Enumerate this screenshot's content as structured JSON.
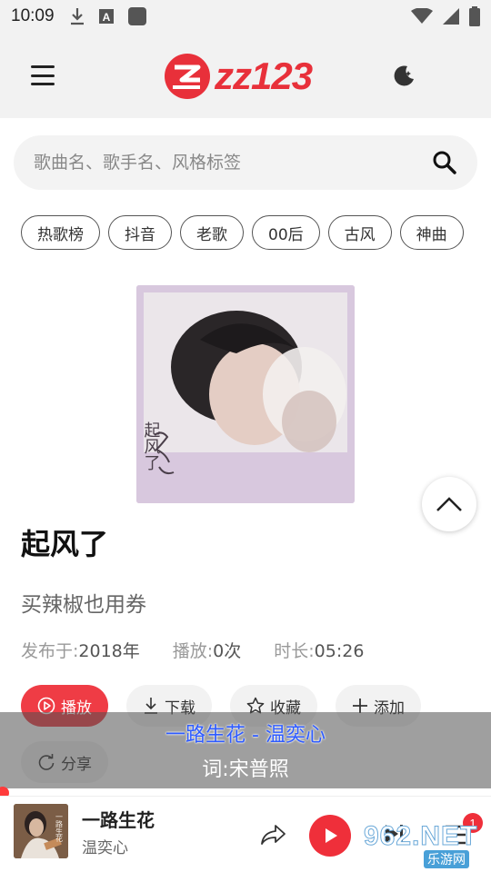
{
  "status_bar": {
    "time": "10:09"
  },
  "header": {
    "logo_text": "zz123",
    "accent_color": "#e8303a"
  },
  "search": {
    "placeholder": "歌曲名、歌手名、风格标签"
  },
  "tags": [
    "热歌榜",
    "抖音",
    "老歌",
    "00后",
    "古风",
    "神曲"
  ],
  "song": {
    "title": "起风了",
    "subtitle": "买辣椒也用券",
    "published_label": "发布于:",
    "published_value": "2018年",
    "plays_label": "播放:",
    "plays_value": "0次",
    "duration_label": "时长:",
    "duration_value": "05:26",
    "cover_text": "起风了"
  },
  "actions": {
    "play": "播放",
    "download": "下载",
    "favorite": "收藏",
    "add": "添加",
    "share": "分享"
  },
  "lyrics": {
    "line1": "一路生花 - 温奕心",
    "line2": "词:宋普照"
  },
  "player": {
    "title": "一路生花",
    "artist": "温奕心",
    "cover_text": "一路生花",
    "queue_count": "1"
  },
  "watermark": {
    "text": "962.NET",
    "sub": "乐游网"
  }
}
